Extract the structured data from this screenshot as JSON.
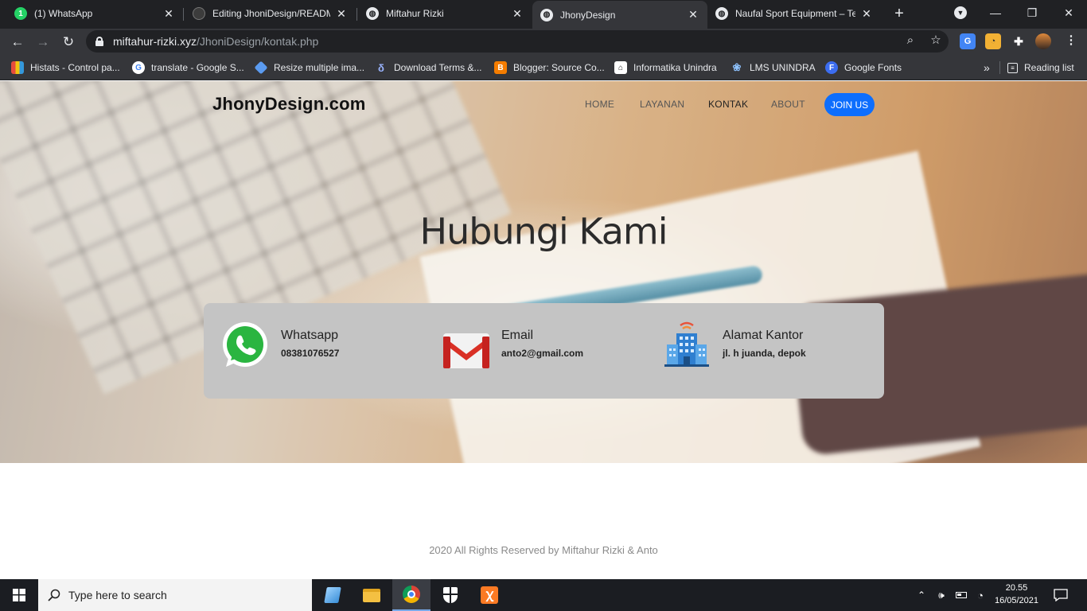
{
  "browser": {
    "tabs": [
      {
        "title": "(1) WhatsApp",
        "icon": "whatsapp-icon"
      },
      {
        "title": "Editing JhoniDesign/README.",
        "icon": "github-icon"
      },
      {
        "title": "Miftahur Rizki",
        "icon": "globe-icon"
      },
      {
        "title": "JhonyDesign",
        "icon": "globe-icon",
        "active": true
      },
      {
        "title": "Naufal Sport Equipment – Ter",
        "icon": "globe-icon"
      }
    ],
    "whatsapp_badge": "1",
    "url_host": "miftahur-rizki.xyz",
    "url_path": "/JhoniDesign/kontak.php",
    "bookmarks": [
      "Histats - Control pa...",
      "translate - Google S...",
      "Resize multiple ima...",
      "Download Terms &...",
      "Blogger: Source Co...",
      "Informatika Unindra",
      "LMS UNINDRA",
      "Google Fonts"
    ],
    "reading_list": "Reading list",
    "more_bookmarks": "»"
  },
  "site": {
    "brand": "JhonyDesign.com",
    "nav": [
      "HOME",
      "LAYANAN",
      "KONTAK",
      "ABOUT"
    ],
    "active_nav": "KONTAK",
    "join_button": "JOIN US",
    "hero_title": "Hubungi Kami",
    "contacts": [
      {
        "title": "Whatsapp",
        "value": "08381076527",
        "icon": "whatsapp-icon"
      },
      {
        "title": "Email",
        "value": "anto2@gmail.com",
        "icon": "gmail-icon"
      },
      {
        "title": "Alamat Kantor",
        "value": "jl. h juanda, depok",
        "icon": "office-building-icon"
      }
    ],
    "footer": "2020 All Rights Reserved by Miftahur Rizki & Anto"
  },
  "taskbar": {
    "search_placeholder": "Type here to search",
    "time": "20.55",
    "date": "16/05/2021"
  },
  "colors": {
    "accent": "#0d6efd",
    "browser_dark": "#202124",
    "browser_toolbar": "#35363a",
    "card": "#c4c4c4"
  }
}
